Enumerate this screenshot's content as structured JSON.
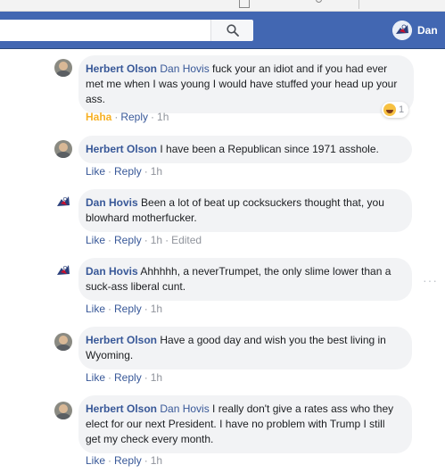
{
  "header": {
    "search_placeholder": "",
    "profile_name": "Dan"
  },
  "colors": {
    "facebook_blue": "#4267b2",
    "link_blue": "#385898",
    "bubble_gray": "#f2f3f5",
    "haha_yellow": "#f7b125",
    "meta_gray": "#90949c"
  },
  "icons": {
    "search": "search-icon",
    "haha_reaction": "haha-emoji-icon",
    "more": "more-options-icon"
  },
  "comments": [
    {
      "author": "Herbert Olson",
      "tag": "Dan Hovis",
      "text": " fuck your an idiot and if you had ever met me when I was young I would have stuffed your head up your ass.",
      "reaction_label": "Haha",
      "reply_label": "Reply",
      "time": "1h",
      "reaction_count": "1"
    },
    {
      "author": "Herbert Olson",
      "tag": "",
      "text": " I have been a Republican since 1971 asshole.",
      "like_label": "Like",
      "reply_label": "Reply",
      "time": "1h"
    },
    {
      "author": "Dan Hovis",
      "tag": "",
      "text": " Been a lot of beat up cocksuckers thought that, you blowhard motherfucker.",
      "like_label": "Like",
      "reply_label": "Reply",
      "time": "1h",
      "edited": "Edited"
    },
    {
      "author": "Dan Hovis",
      "tag": "",
      "text": " Ahhhhh, a neverTrumpet, the only slime lower than a suck-ass liberal cunt.",
      "like_label": "Like",
      "reply_label": "Reply",
      "time": "1h",
      "more_glyph": "···"
    },
    {
      "author": "Herbert Olson",
      "tag": "",
      "text": " Have a good day and wish you the best living in Wyoming.",
      "like_label": "Like",
      "reply_label": "Reply",
      "time": "1h"
    },
    {
      "author": "Herbert Olson",
      "tag": "Dan Hovis",
      "text": " I really don't give a rates ass who they elect for our next President. I have no problem with Trump I still get my check every month.",
      "like_label": "Like",
      "reply_label": "Reply",
      "time": "1h"
    }
  ]
}
